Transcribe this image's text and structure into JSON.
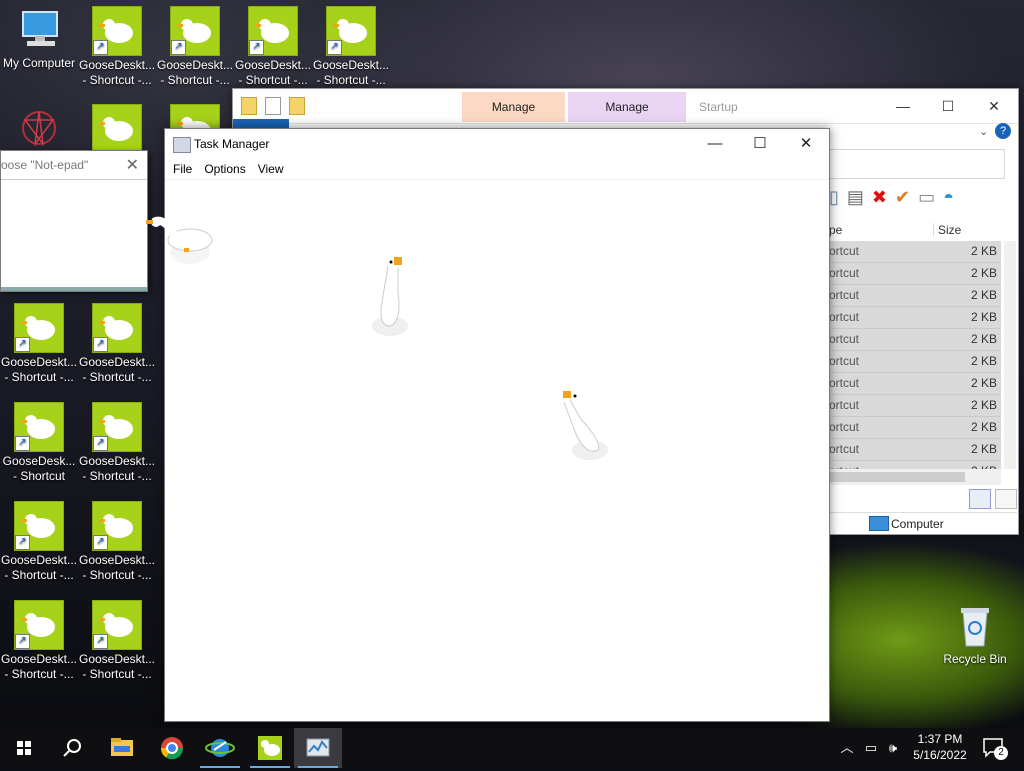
{
  "desktop": {
    "my_computer": "My Computer",
    "recycle_bin": "Recycle Bin",
    "top_shortcuts": [
      "GooseDeskt...\n- Shortcut -...",
      "GooseDeskt...\n- Shortcut -...",
      "GooseDeskt...\n- Shortcut -...",
      "GooseDeskt...\n- Shortcut -..."
    ],
    "grid_shortcuts": [
      "GooseDeskt...\n- Shortcut -...",
      "GooseDeskt...\n- Shortcut -...",
      "GooseDesk...\n- Shortcut",
      "GooseDeskt...\n- Shortcut -...",
      "GooseDeskt...\n- Shortcut -...",
      "GooseDeskt...\n- Shortcut -...",
      "GooseDeskt...\n- Shortcut -...",
      "GooseDeskt...\n- Shortcut -..."
    ]
  },
  "notepad_dialog": {
    "title": "oose \"Not-epad\"",
    "close": "✕"
  },
  "explorer": {
    "manage_1": "Manage",
    "manage_2": "Manage",
    "startup_tab": "Startup",
    "col_type": "pe",
    "col_size": "Size",
    "rows": [
      {
        "type": "ortcut",
        "size": "2 KB"
      },
      {
        "type": "ortcut",
        "size": "2 KB"
      },
      {
        "type": "ortcut",
        "size": "2 KB"
      },
      {
        "type": "ortcut",
        "size": "2 KB"
      },
      {
        "type": "ortcut",
        "size": "2 KB"
      },
      {
        "type": "ortcut",
        "size": "2 KB"
      },
      {
        "type": "ortcut",
        "size": "2 KB"
      },
      {
        "type": "ortcut",
        "size": "2 KB"
      },
      {
        "type": "ortcut",
        "size": "2 KB"
      },
      {
        "type": "ortcut",
        "size": "2 KB"
      },
      {
        "type": "ortcut",
        "size": "2 KB"
      }
    ],
    "status_location": "Computer",
    "colors": {
      "manage_1": "#fbd9c4",
      "manage_2": "#ead4f4"
    }
  },
  "taskmgr": {
    "title": "Task Manager",
    "menu": [
      "File",
      "Options",
      "View"
    ],
    "minimize": "—",
    "maximize": "☐",
    "close": "✕"
  },
  "taskbar": {
    "time": "1:37 PM",
    "date": "5/16/2022",
    "notification_count": "2",
    "icons": [
      "windows-start-icon",
      "search-icon",
      "file-explorer-icon",
      "chrome-icon",
      "internet-explorer-icon",
      "goose-icon",
      "task-manager-icon"
    ]
  }
}
